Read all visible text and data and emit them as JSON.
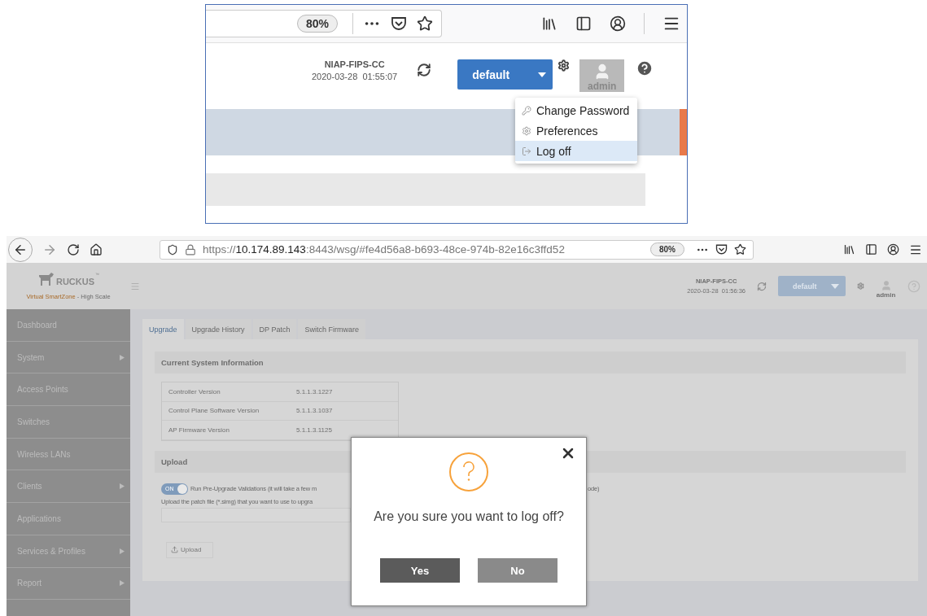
{
  "inset": {
    "browser": {
      "zoom": "80%"
    },
    "header": {
      "system": "NIAP-FIPS-CC",
      "datetime": "2020-03-28  01:55:07",
      "domain": "default",
      "user": "admin"
    },
    "user_menu": [
      {
        "label": "Change Password",
        "kind": "password",
        "selected": false
      },
      {
        "label": "Preferences",
        "kind": "preferences",
        "selected": false
      },
      {
        "label": "Log off",
        "kind": "logoff",
        "selected": true
      }
    ]
  },
  "browser": {
    "url_scheme": "https://",
    "url_host": "10.174.89.143",
    "url_rest": ":8443/wsg/#fe4d56a8-b693-48ce-974b-82e16c3ffd52",
    "zoom": "80%"
  },
  "app": {
    "brand": "RUCKUS",
    "trademark": "™",
    "product": "Virtual SmartZone",
    "edition": " - High Scale",
    "header": {
      "system": "NIAP-FIPS-CC",
      "datetime": "2020-03-28  01:56:36",
      "domain": "default",
      "user": "admin"
    }
  },
  "sidebar": {
    "items": [
      {
        "label": "Dashboard",
        "has_submenu": false
      },
      {
        "label": "System",
        "has_submenu": true
      },
      {
        "label": "Access Points",
        "has_submenu": false
      },
      {
        "label": "Switches",
        "has_submenu": false
      },
      {
        "label": "Wireless LANs",
        "has_submenu": false
      },
      {
        "label": "Clients",
        "has_submenu": true
      },
      {
        "label": "Applications",
        "has_submenu": false
      },
      {
        "label": "Services & Profiles",
        "has_submenu": true
      },
      {
        "label": "Report",
        "has_submenu": true
      }
    ]
  },
  "tabs": [
    {
      "label": "Upgrade",
      "selected": true
    },
    {
      "label": "Upgrade History",
      "selected": false
    },
    {
      "label": "DP Patch",
      "selected": false
    },
    {
      "label": "Switch Firmware",
      "selected": false
    }
  ],
  "system_info": {
    "title": "Current System Information",
    "rows": [
      {
        "label": "Controller Version",
        "value": "5.1.1.3.1227"
      },
      {
        "label": "Control Plane Software Version",
        "value": "5.1.1.3.1037"
      },
      {
        "label": "AP Firmware Version",
        "value": "5.1.1.3.1125"
      }
    ]
  },
  "upload": {
    "title": "Upload",
    "toggle": {
      "label": "ON",
      "on": true
    },
    "validation_text_left": "Run Pre-Upgrade Validations (it will take a few m",
    "validation_text_right": "ode)",
    "patch_text": "Upload the patch file (*.simg) that you want to use to upgra",
    "button": "Upload"
  },
  "dialog": {
    "message": "Are you sure you want to log off?",
    "yes": "Yes",
    "no": "No"
  }
}
